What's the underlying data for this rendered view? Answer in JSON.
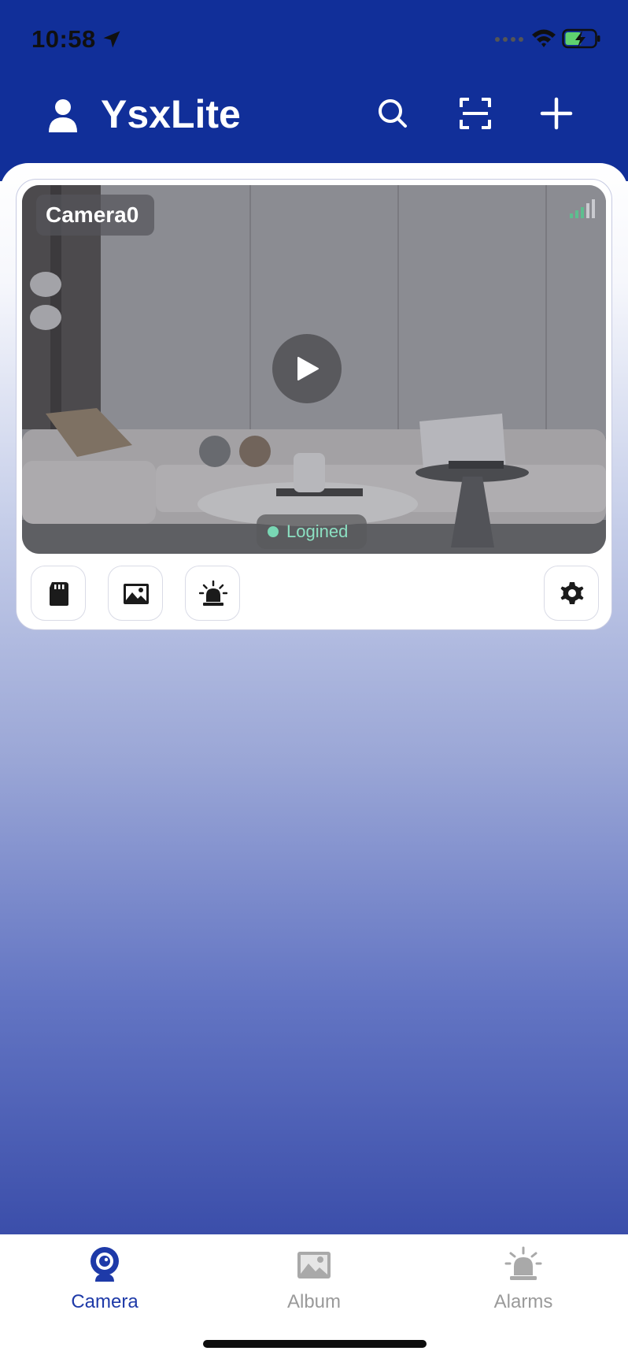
{
  "status_bar": {
    "time": "10:58",
    "icons": [
      "location-arrow-icon",
      "cellular-dots-icon",
      "wifi-icon",
      "battery-charging-icon"
    ]
  },
  "app_bar": {
    "title": "YsxLite",
    "icons": [
      "user-icon",
      "search-icon",
      "scan-icon",
      "plus-icon"
    ],
    "accent_color": "#112f99"
  },
  "camera": {
    "name": "Camera0",
    "status": "Logined",
    "status_color": "#79d7b4",
    "tools": [
      "sd-card-icon",
      "album-icon",
      "alarm-siren-icon",
      "settings-gear-icon"
    ]
  },
  "tabs": [
    {
      "label": "Camera",
      "icon": "camera-icon",
      "active": true
    },
    {
      "label": "Album",
      "icon": "album-icon",
      "active": false
    },
    {
      "label": "Alarms",
      "icon": "alarm-siren-icon",
      "active": false
    }
  ]
}
